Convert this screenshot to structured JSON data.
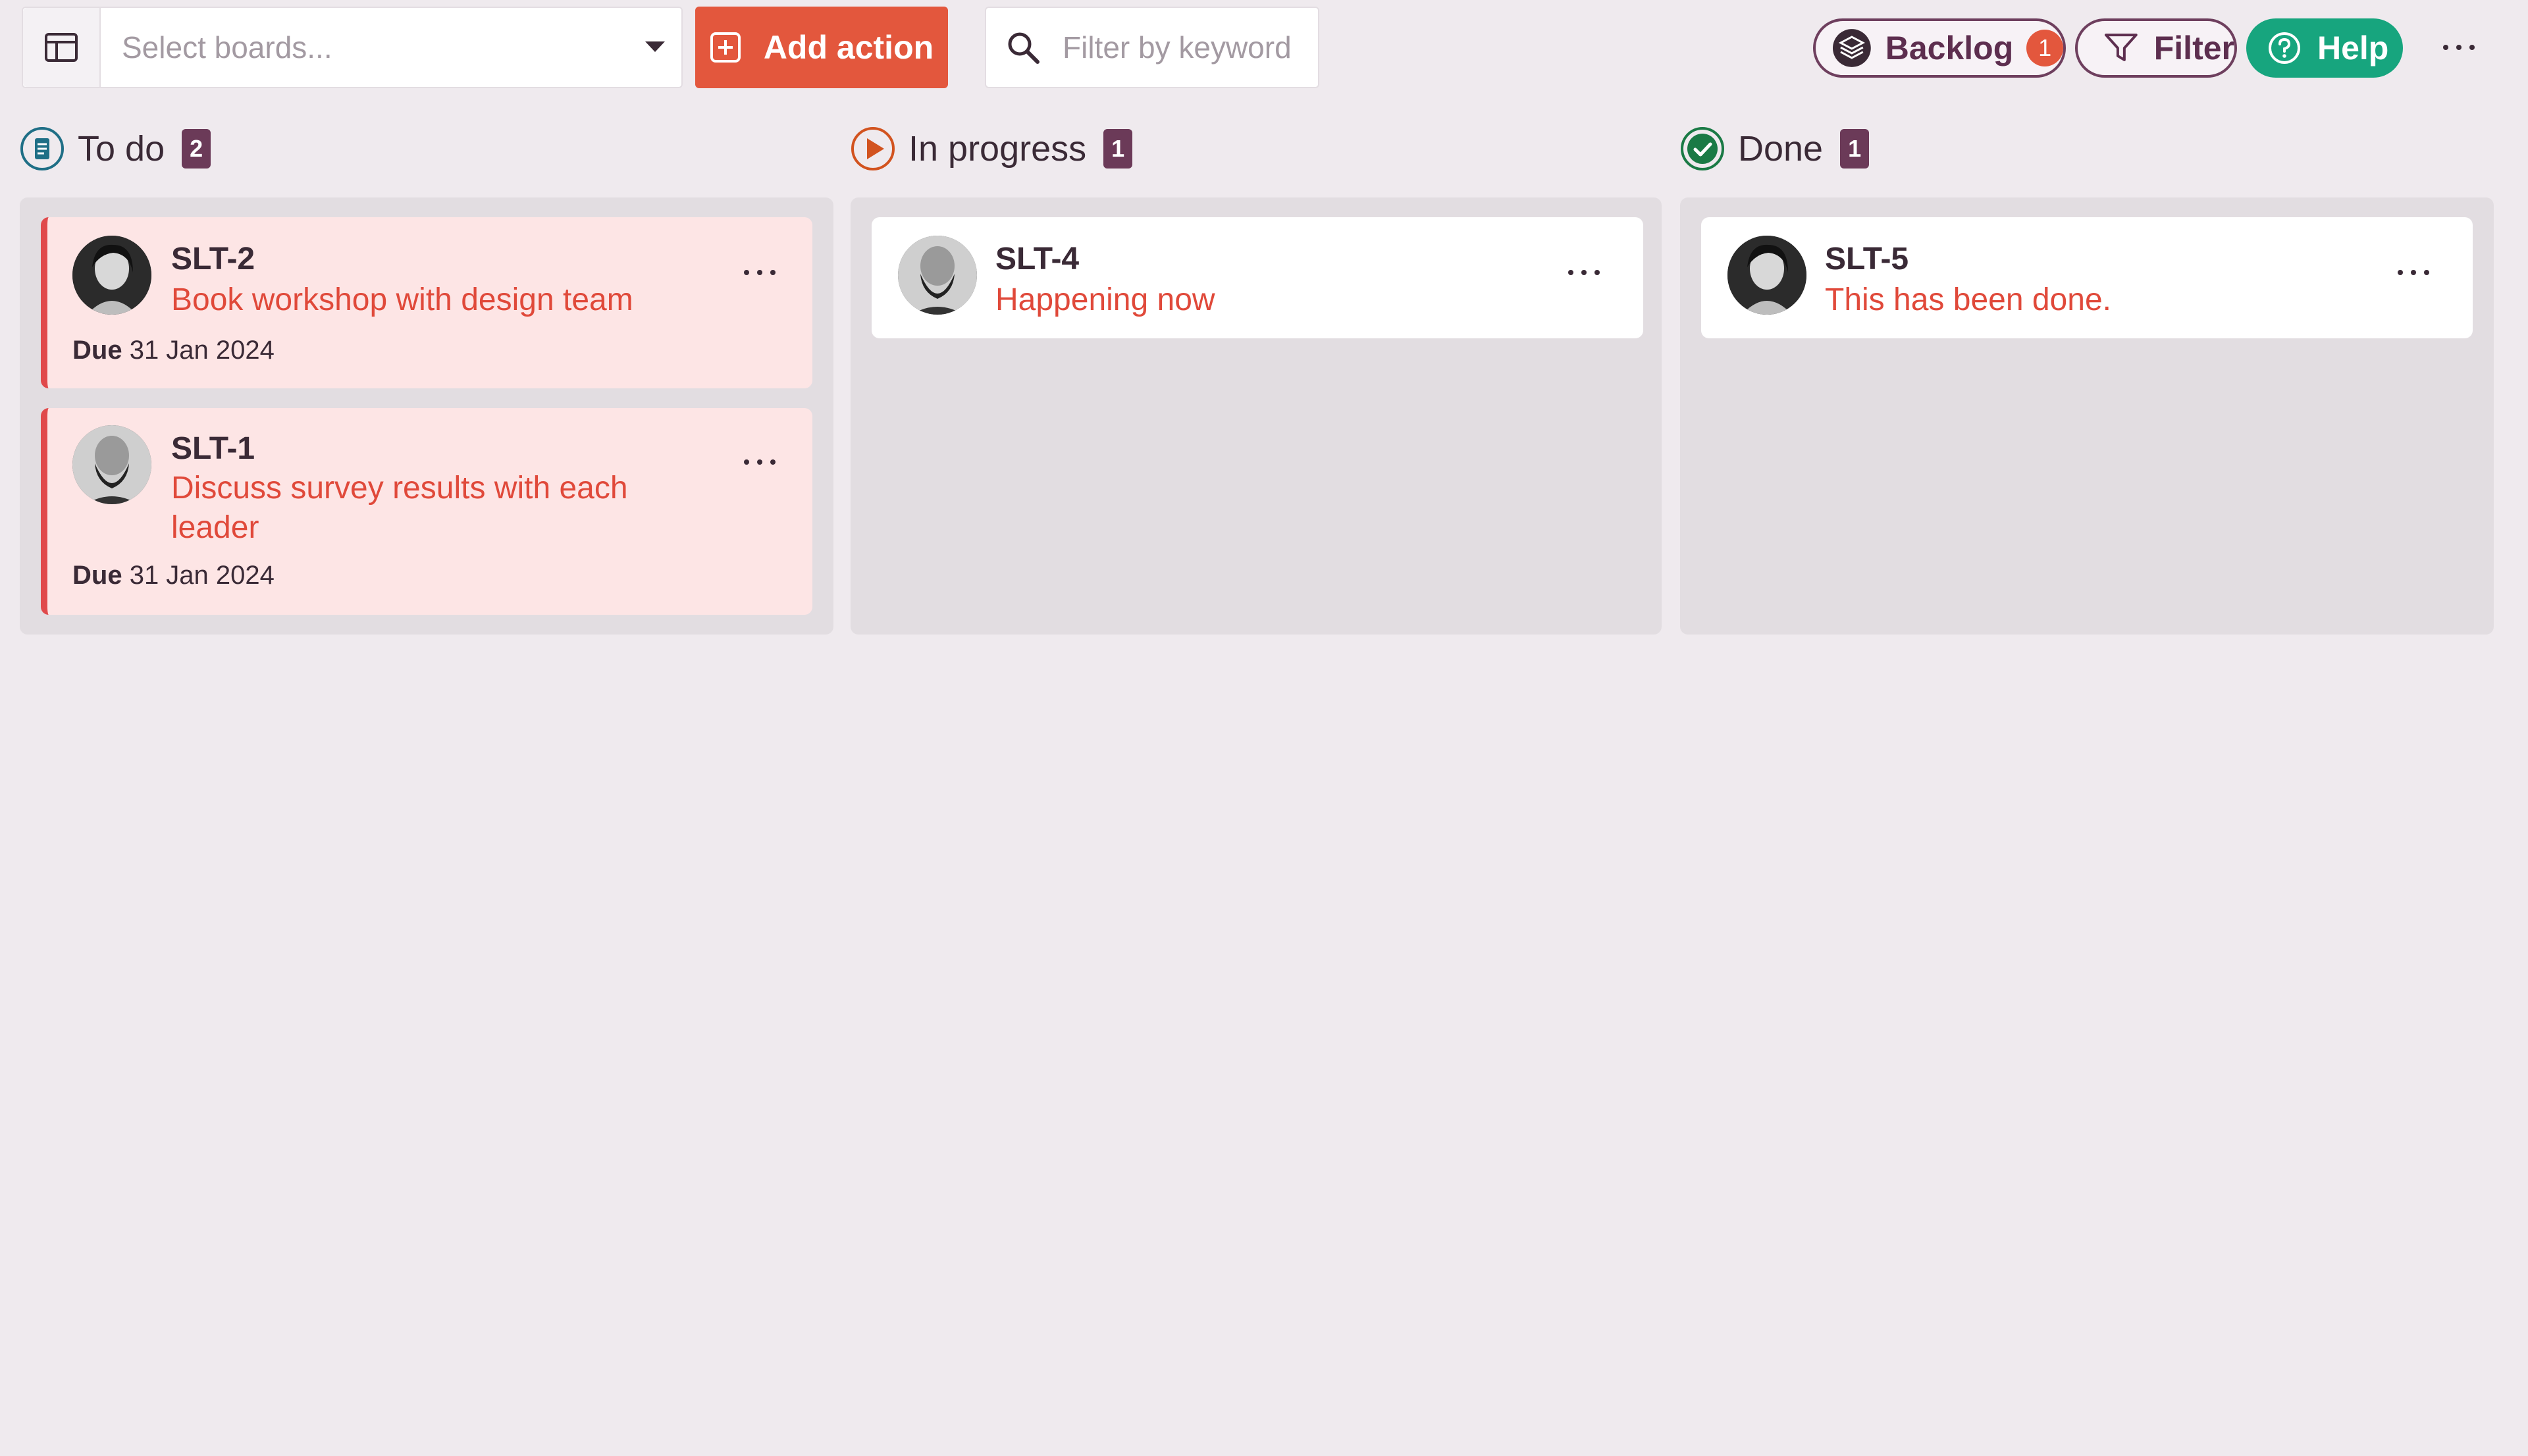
{
  "toolbar": {
    "board_select_placeholder": "Select boards...",
    "add_action_label": "Add action",
    "filter_keyword_placeholder": "Filter by keyword",
    "backlog_label": "Backlog",
    "backlog_count": "1",
    "filter_label": "Filter",
    "help_label": "Help"
  },
  "columns": [
    {
      "title": "To do",
      "count": "2",
      "cards": [
        {
          "key": "SLT-2",
          "title": "Book workshop with design team",
          "due_label": "Due",
          "due_date": "31 Jan 2024"
        },
        {
          "key": "SLT-1",
          "title": "Discuss survey results with each leader",
          "due_label": "Due",
          "due_date": "31 Jan 2024"
        }
      ]
    },
    {
      "title": "In progress",
      "count": "1",
      "cards": [
        {
          "key": "SLT-4",
          "title": "Happening now"
        }
      ]
    },
    {
      "title": "Done",
      "count": "1",
      "cards": [
        {
          "key": "SLT-5",
          "title": "This has been done."
        }
      ]
    }
  ],
  "colors": {
    "background": "#efeaee",
    "accent_orange": "#e3573d",
    "help_green": "#17a57e",
    "plum": "#6b3a58",
    "overdue_bg": "#fde5e5",
    "overdue_border": "#e0494b",
    "title_red": "#e0493a"
  }
}
